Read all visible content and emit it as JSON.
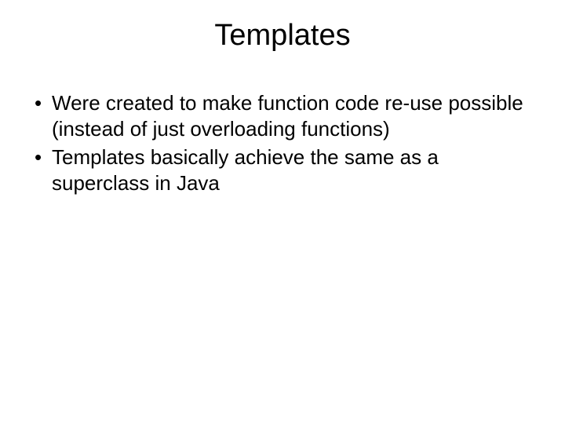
{
  "slide": {
    "title": "Templates",
    "bullets": [
      "Were created to make function code re-use possible (instead of just overloading functions)",
      "Templates basically achieve the same as a superclass in Java"
    ]
  }
}
